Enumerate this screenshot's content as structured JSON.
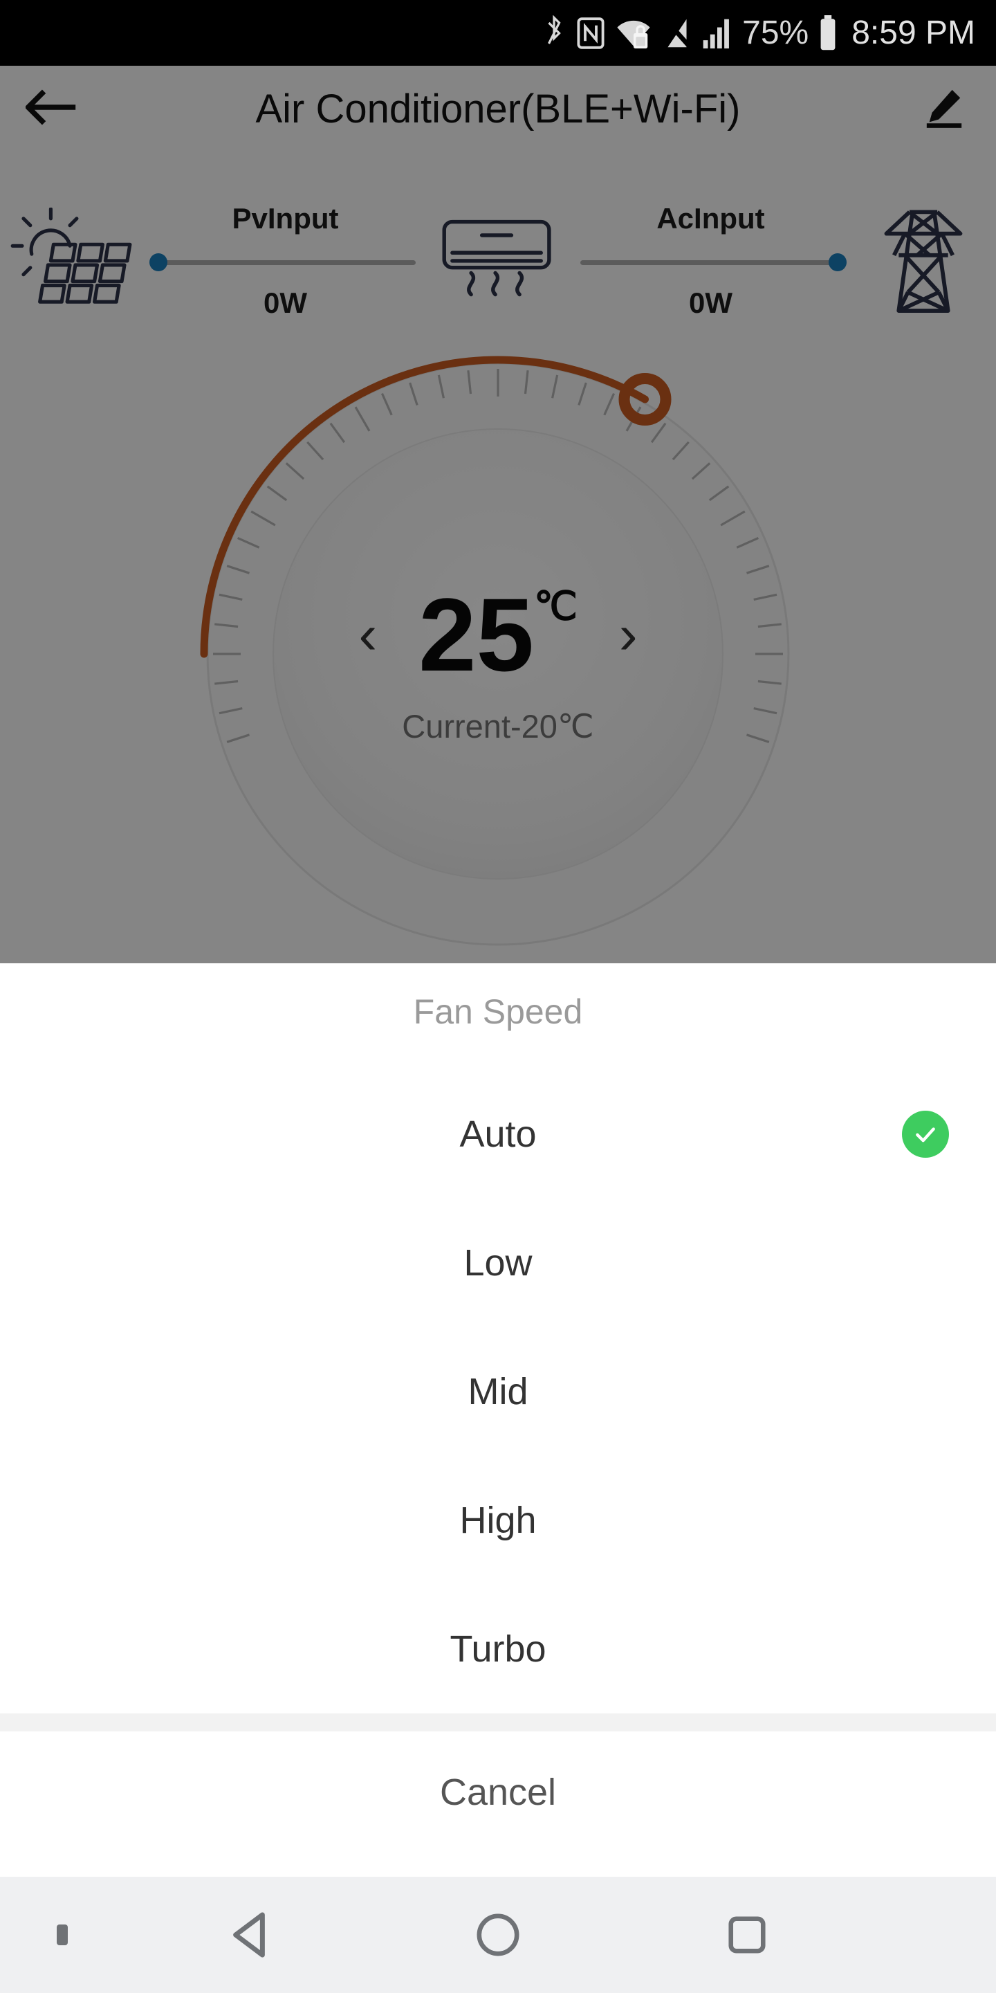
{
  "status_bar": {
    "icons": [
      "bluetooth-icon",
      "nfc-icon",
      "wifi-lock-icon",
      "signal-off-icon",
      "cellular-signal-icon"
    ],
    "battery_percent": "75%",
    "battery_icon": "battery-icon",
    "time": "8:59 PM"
  },
  "app": {
    "back_icon": "back-arrow-icon",
    "title": "Air Conditioner(BLE+Wi-Fi)",
    "edit_icon": "edit-pencil-icon",
    "flow": {
      "source_icon": "solar-panel-icon",
      "device_icon": "air-conditioner-icon",
      "grid_icon": "power-pylon-icon",
      "segments": [
        {
          "label": "PvInput",
          "value": "0W",
          "dot_side": "left",
          "dot_color": "#1879b5"
        },
        {
          "label": "AcInput",
          "value": "0W",
          "dot_side": "right",
          "dot_color": "#1879b5"
        }
      ]
    },
    "dial": {
      "set_temperature": "25",
      "unit": "℃",
      "current_label": "Current-20℃",
      "decrease_icon": "chevron-left-icon",
      "increase_icon": "chevron-right-icon",
      "arc_color": "#c2581f",
      "arc_start_deg": 180,
      "arc_end_deg": 30,
      "handle_icon": "dial-handle-icon"
    }
  },
  "sheet": {
    "title": "Fan Speed",
    "options": [
      {
        "label": "Auto",
        "selected": true
      },
      {
        "label": "Low",
        "selected": false
      },
      {
        "label": "Mid",
        "selected": false
      },
      {
        "label": "High",
        "selected": false
      },
      {
        "label": "Turbo",
        "selected": false
      }
    ],
    "selected_icon": "check-circle-icon",
    "selected_color": "#3ecc5f",
    "cancel_label": "Cancel"
  },
  "navbar": {
    "items": [
      "dot-indicator-icon",
      "back-triangle-icon",
      "home-circle-icon",
      "recents-square-icon"
    ]
  }
}
